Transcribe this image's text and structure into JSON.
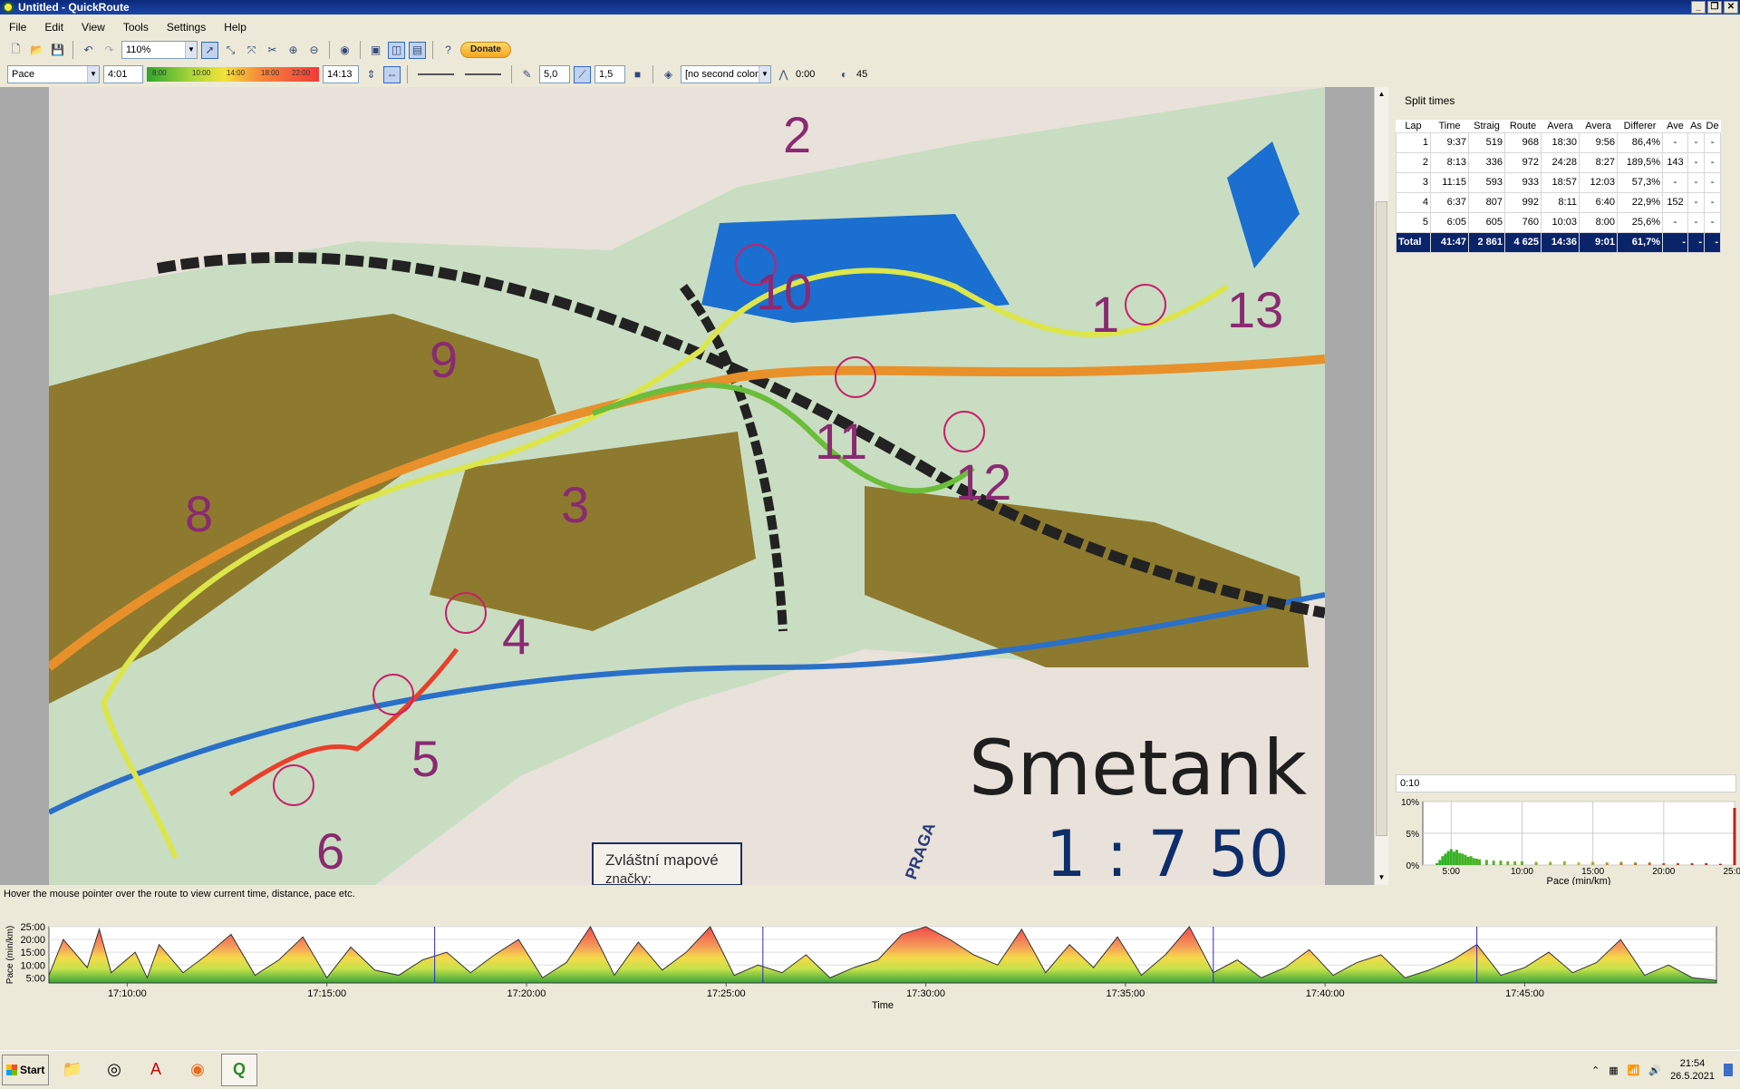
{
  "window": {
    "title": "Untitled - QuickRoute",
    "min": "_",
    "max": "❐",
    "close": "✕"
  },
  "menu": [
    "File",
    "Edit",
    "View",
    "Tools",
    "Settings",
    "Help"
  ],
  "toolbar": {
    "zoom": "110%",
    "donate": "Donate"
  },
  "toolbar2": {
    "color_coding": "Pace",
    "low_value": "4:01",
    "scale_ticks": [
      "8:00",
      "10:00",
      "14:00",
      "18:00",
      "22:00"
    ],
    "high_value": "14:13",
    "line_width": "5,0",
    "mask_width": "1,5",
    "second_color": "[no second color",
    "smoothing": "0:00",
    "circle": "45"
  },
  "map": {
    "labels": [
      "2",
      "10",
      "1",
      "13",
      "9",
      "11",
      "12",
      "8",
      "3",
      "4",
      "5",
      "6"
    ],
    "title": "Smetank",
    "scale": "1 : 7 50",
    "legend": "Zvláštní mapové",
    "legend2": "značky:",
    "badge": "PRAGA"
  },
  "splits": {
    "title": "Split times",
    "columns": [
      "Lap",
      "Time",
      "Straig",
      "Route",
      "Avera",
      "Avera",
      "Differer",
      "Ave",
      "As",
      "De"
    ],
    "rows": [
      [
        "1",
        "9:37",
        "519",
        "968",
        "18:30",
        "9:56",
        "86,4%",
        "-",
        "-",
        "-"
      ],
      [
        "2",
        "8:13",
        "336",
        "972",
        "24:28",
        "8:27",
        "189,5%",
        "143",
        "-",
        "-"
      ],
      [
        "3",
        "11:15",
        "593",
        "933",
        "18:57",
        "12:03",
        "57,3%",
        "-",
        "-",
        "-"
      ],
      [
        "4",
        "6:37",
        "807",
        "992",
        "8:11",
        "6:40",
        "22,9%",
        "152",
        "-",
        "-"
      ],
      [
        "5",
        "6:05",
        "605",
        "760",
        "10:03",
        "8:00",
        "25,6%",
        "-",
        "-",
        "-"
      ]
    ],
    "total": [
      "Total",
      "41:47",
      "2 861",
      "4 625",
      "14:36",
      "9:01",
      "61,7%",
      "-",
      "-",
      "-"
    ]
  },
  "histogram": {
    "interval": "0:10",
    "chart_data": {
      "type": "bar",
      "title": "",
      "xlabel": "Pace (min/km)",
      "ylabel": "",
      "x_ticks": [
        "5:00",
        "10:00",
        "15:00",
        "20:00",
        "25:00"
      ],
      "y_ticks": [
        "0%",
        "5%",
        "10%"
      ],
      "xlim": [
        3,
        25
      ],
      "ylim": [
        0,
        10
      ],
      "x": [
        4.0,
        4.2,
        4.4,
        4.6,
        4.8,
        5.0,
        5.2,
        5.4,
        5.6,
        5.8,
        6.0,
        6.2,
        6.4,
        6.6,
        6.8,
        7.0,
        7.5,
        8.0,
        8.5,
        9.0,
        9.5,
        10,
        11,
        12,
        13,
        14,
        15,
        16,
        17,
        18,
        19,
        20,
        21,
        22,
        23,
        24,
        25
      ],
      "values": [
        0.3,
        0.8,
        1.4,
        1.8,
        2.2,
        2.5,
        2.1,
        2.4,
        1.9,
        1.8,
        1.6,
        1.3,
        1.4,
        1.1,
        1.0,
        0.9,
        0.8,
        0.7,
        0.7,
        0.6,
        0.6,
        0.6,
        0.5,
        0.5,
        0.6,
        0.4,
        0.5,
        0.4,
        0.5,
        0.4,
        0.4,
        0.3,
        0.3,
        0.3,
        0.3,
        0.2,
        9.0
      ]
    }
  },
  "status": "Hover the mouse pointer over the route to view current time, distance, pace etc.",
  "line_graph": {
    "chart_data": {
      "type": "area",
      "title": "",
      "xlabel": "Time",
      "ylabel": "Pace (min/km)",
      "y_ticks": [
        "25:00",
        "20:00",
        "15:00",
        "10:00",
        "5:00"
      ],
      "x_ticks": [
        "17:10:00",
        "17:15:00",
        "17:20:00",
        "17:25:00",
        "17:30:00",
        "17:35:00",
        "17:40:00",
        "17:45:00"
      ],
      "xlim": [
        17.134,
        17.83
      ],
      "ylim": [
        3,
        25
      ],
      "lap_markers": [
        17.295,
        17.432,
        17.62,
        17.73
      ],
      "x": [
        17.134,
        17.14,
        17.15,
        17.155,
        17.16,
        17.17,
        17.175,
        17.18,
        17.19,
        17.2,
        17.21,
        17.22,
        17.23,
        17.24,
        17.25,
        17.26,
        17.27,
        17.28,
        17.29,
        17.3,
        17.31,
        17.32,
        17.33,
        17.34,
        17.35,
        17.36,
        17.37,
        17.38,
        17.39,
        17.4,
        17.41,
        17.42,
        17.43,
        17.44,
        17.45,
        17.46,
        17.47,
        17.48,
        17.49,
        17.5,
        17.51,
        17.52,
        17.53,
        17.54,
        17.55,
        17.56,
        17.57,
        17.58,
        17.59,
        17.6,
        17.61,
        17.62,
        17.63,
        17.64,
        17.65,
        17.66,
        17.67,
        17.68,
        17.69,
        17.7,
        17.71,
        17.72,
        17.73,
        17.74,
        17.75,
        17.76,
        17.77,
        17.78,
        17.79,
        17.8,
        17.81,
        17.82,
        17.83
      ],
      "values": [
        6,
        20,
        9,
        24,
        7,
        15,
        5,
        18,
        7,
        14,
        22,
        6,
        12,
        21,
        5,
        17,
        8,
        6,
        12,
        15,
        7,
        14,
        20,
        5,
        11,
        25,
        6,
        19,
        8,
        15,
        25,
        6,
        10,
        7,
        14,
        5,
        9,
        12,
        22,
        25,
        20,
        14,
        10,
        24,
        7,
        18,
        9,
        21,
        6,
        14,
        25,
        7,
        12,
        5,
        9,
        16,
        6,
        11,
        14,
        5,
        8,
        12,
        18,
        6,
        9,
        15,
        7,
        11,
        20,
        6,
        10,
        5,
        4
      ]
    }
  },
  "taskbar": {
    "start": "Start",
    "time": "21:54",
    "date": "26.5.2021"
  }
}
